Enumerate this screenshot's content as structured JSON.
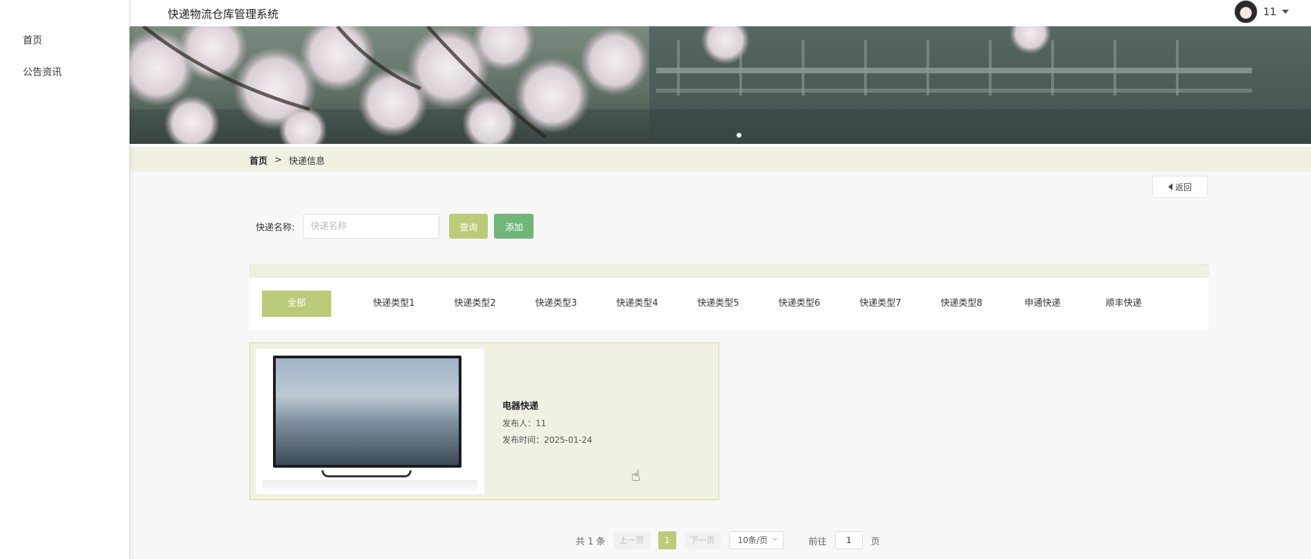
{
  "header": {
    "title": "快递物流仓库管理系统",
    "user_name": "11"
  },
  "sidebar": {
    "items": [
      {
        "label": "首页"
      },
      {
        "label": "公告资讯"
      }
    ]
  },
  "breadcrumb": {
    "home": "首页",
    "separator": ">",
    "current": "快递信息"
  },
  "toolbar": {
    "back_label": "返回",
    "search_label": "快递名称:",
    "search_placeholder": "快递名称",
    "search_value": "",
    "query_label": "查询",
    "add_label": "添加"
  },
  "categories": {
    "items": [
      {
        "label": "全部"
      },
      {
        "label": "快递类型1"
      },
      {
        "label": "快递类型2"
      },
      {
        "label": "快递类型3"
      },
      {
        "label": "快递类型4"
      },
      {
        "label": "快递类型5"
      },
      {
        "label": "快递类型6"
      },
      {
        "label": "快递类型7"
      },
      {
        "label": "快递类型8"
      },
      {
        "label": "申通快递"
      },
      {
        "label": "顺丰快递"
      }
    ]
  },
  "cards": [
    {
      "title": "电器快递",
      "publisher": "发布人：11",
      "publish_time": "发布时间：2025-01-24"
    }
  ],
  "pagination": {
    "total": "共 1 条",
    "prev": "上一页",
    "current": "1",
    "next": "下一页",
    "page_size": "10条/页",
    "goto_prefix": "前往",
    "goto_value": "1",
    "goto_suffix": "页"
  },
  "colors": {
    "accent": "#bccb78",
    "add_green": "#6fb679",
    "strip_bg": "#f0f1e3"
  }
}
